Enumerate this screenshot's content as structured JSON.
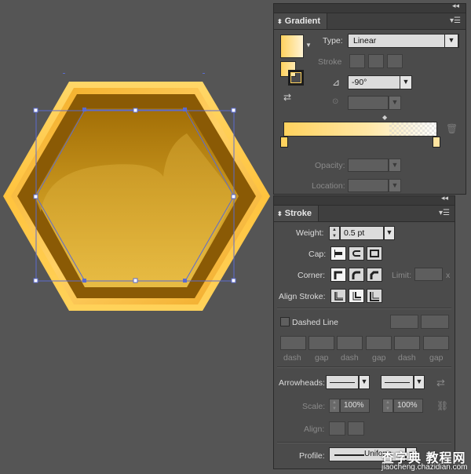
{
  "gradient_panel": {
    "title": "Gradient",
    "type_label": "Type:",
    "type_value": "Linear",
    "stroke_label": "Stroke",
    "angle_value": "-90°",
    "opacity_label": "Opacity:",
    "location_label": "Location:",
    "colors": {
      "start": "#ffd25e",
      "end": "#ffffff"
    }
  },
  "stroke_panel": {
    "title": "Stroke",
    "weight_label": "Weight:",
    "weight_value": "0.5 pt",
    "cap_label": "Cap:",
    "corner_label": "Corner:",
    "limit_label": "Limit:",
    "limit_unit": "x",
    "align_label": "Align Stroke:",
    "dashed_label": "Dashed Line",
    "dash_labels": [
      "dash",
      "gap",
      "dash",
      "gap",
      "dash",
      "gap"
    ],
    "arrowheads_label": "Arrowheads:",
    "scale_label": "Scale:",
    "scale_start": "100%",
    "scale_end": "100%",
    "align_arrow_label": "Align:",
    "profile_label": "Profile:",
    "profile_value": "Uniform"
  },
  "watermark": {
    "line1": "查字典 教程网",
    "line2": "jiaocheng.chazidian.com"
  },
  "artwork": {
    "hex_outer": "#ffc94a",
    "hex_frame": "#f4b22c",
    "hex_dark": "#8a5a05",
    "hex_fill_top": "#b07a0c",
    "hex_fill_bottom": "#e8bb40",
    "path_color": "#5b6bd0"
  }
}
